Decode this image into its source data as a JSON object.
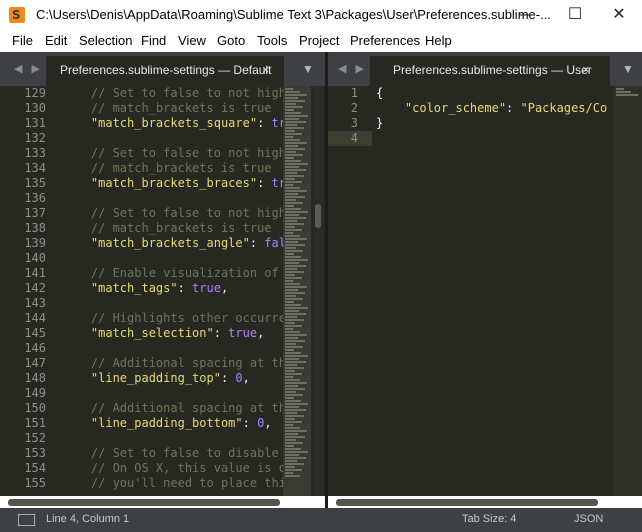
{
  "window": {
    "title": "C:\\Users\\Denis\\AppData\\Roaming\\Sublime Text 3\\Packages\\User\\Preferences.sublime-...",
    "app_icon_letter": "S",
    "minimize_label": "—",
    "maximize_label": "☐",
    "close_label": "✕"
  },
  "menu": [
    "File",
    "Edit",
    "Selection",
    "Find",
    "View",
    "Goto",
    "Tools",
    "Project",
    "Preferences",
    "Help"
  ],
  "left_pane": {
    "nav_arrows": "◀ ▶",
    "tab_label": "Preferences.sublime-settings — Default",
    "tab_close": "×",
    "dropdown": "▼",
    "line_numbers": [
      "129",
      "130",
      "131",
      "132",
      "133",
      "134",
      "135",
      "136",
      "137",
      "138",
      "139",
      "140",
      "141",
      "142",
      "143",
      "144",
      "145",
      "146",
      "147",
      "148",
      "149",
      "150",
      "151",
      "152",
      "153",
      "154",
      "155"
    ],
    "lines": [
      [
        {
          "t": "    // Set to false to not high",
          "c": "comment"
        }
      ],
      [
        {
          "t": "    // match_brackets is true",
          "c": "comment"
        }
      ],
      [
        {
          "t": "    \"match_brackets_square\"",
          "c": "string"
        },
        {
          "t": ": ",
          "c": "plain"
        },
        {
          "t": "tr",
          "c": "const"
        }
      ],
      [],
      [
        {
          "t": "    // Set to false to not high",
          "c": "comment"
        }
      ],
      [
        {
          "t": "    // match_brackets is true",
          "c": "comment"
        }
      ],
      [
        {
          "t": "    \"match_brackets_braces\"",
          "c": "string"
        },
        {
          "t": ": ",
          "c": "plain"
        },
        {
          "t": "tr",
          "c": "const"
        }
      ],
      [],
      [
        {
          "t": "    // Set to false to not high",
          "c": "comment"
        }
      ],
      [
        {
          "t": "    // match_brackets is true",
          "c": "comment"
        }
      ],
      [
        {
          "t": "    \"match_brackets_angle\"",
          "c": "string"
        },
        {
          "t": ": ",
          "c": "plain"
        },
        {
          "t": "fal",
          "c": "const"
        }
      ],
      [],
      [
        {
          "t": "    // Enable visualization of",
          "c": "comment"
        }
      ],
      [
        {
          "t": "    \"match_tags\"",
          "c": "string"
        },
        {
          "t": ": ",
          "c": "plain"
        },
        {
          "t": "true",
          "c": "const"
        },
        {
          "t": ",",
          "c": "plain"
        }
      ],
      [],
      [
        {
          "t": "    // Highlights other occurre",
          "c": "comment"
        }
      ],
      [
        {
          "t": "    \"match_selection\"",
          "c": "string"
        },
        {
          "t": ": ",
          "c": "plain"
        },
        {
          "t": "true",
          "c": "const"
        },
        {
          "t": ",",
          "c": "plain"
        }
      ],
      [],
      [
        {
          "t": "    // Additional spacing at th",
          "c": "comment"
        }
      ],
      [
        {
          "t": "    \"line_padding_top\"",
          "c": "string"
        },
        {
          "t": ": ",
          "c": "plain"
        },
        {
          "t": "0",
          "c": "const"
        },
        {
          "t": ",",
          "c": "plain"
        }
      ],
      [],
      [
        {
          "t": "    // Additional spacing at th",
          "c": "comment"
        }
      ],
      [
        {
          "t": "    \"line_padding_bottom\"",
          "c": "string"
        },
        {
          "t": ": ",
          "c": "plain"
        },
        {
          "t": "0",
          "c": "const"
        },
        {
          "t": ",",
          "c": "plain"
        }
      ],
      [],
      [
        {
          "t": "    // Set to false to disable",
          "c": "comment"
        }
      ],
      [
        {
          "t": "    // On OS X, this value is o",
          "c": "comment"
        }
      ],
      [
        {
          "t": "    // you'll need to place thi",
          "c": "comment"
        }
      ]
    ]
  },
  "right_pane": {
    "nav_arrows": "◀ ▶",
    "tab_label": "Preferences.sublime-settings — User",
    "tab_close": "×",
    "dropdown": "▼",
    "line_numbers": [
      "1",
      "2",
      "3",
      "4"
    ],
    "lines": [
      [
        {
          "t": "{",
          "c": "plain"
        }
      ],
      [
        {
          "t": "    \"color_scheme\"",
          "c": "string"
        },
        {
          "t": ": ",
          "c": "plain"
        },
        {
          "t": "\"Packages/Co",
          "c": "string"
        }
      ],
      [
        {
          "t": "}",
          "c": "plain"
        }
      ],
      []
    ]
  },
  "status": {
    "position": "Line 4, Column 1",
    "tab_size": "Tab Size: 4",
    "syntax": "JSON"
  },
  "colors": {
    "background": "#272822",
    "comment": "#75715e",
    "string": "#e6db74",
    "constant": "#ae81ff",
    "text": "#f8f8f2",
    "chrome": "#3e4044"
  }
}
